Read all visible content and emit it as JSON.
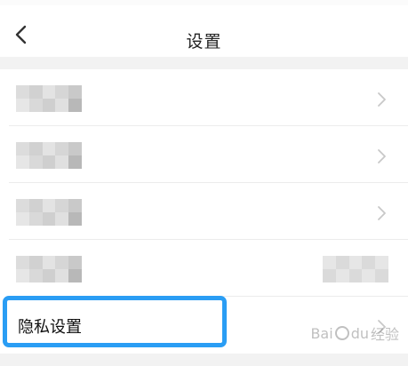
{
  "header": {
    "title": "设置"
  },
  "settings_items": [
    {
      "label": "",
      "blurred": true
    },
    {
      "label": "",
      "blurred": true
    },
    {
      "label": "",
      "blurred": true
    },
    {
      "label": "",
      "blurred": true,
      "has_right_value": true
    },
    {
      "label": "隐私设置",
      "blurred": false,
      "highlighted": true
    }
  ],
  "highlight_color": "#2a9df4",
  "watermark": {
    "left": "Bai",
    "middle": "du",
    "right": "经验"
  },
  "icons": {
    "back": "chevron-left-icon",
    "row_arrow": "chevron-right-icon"
  }
}
